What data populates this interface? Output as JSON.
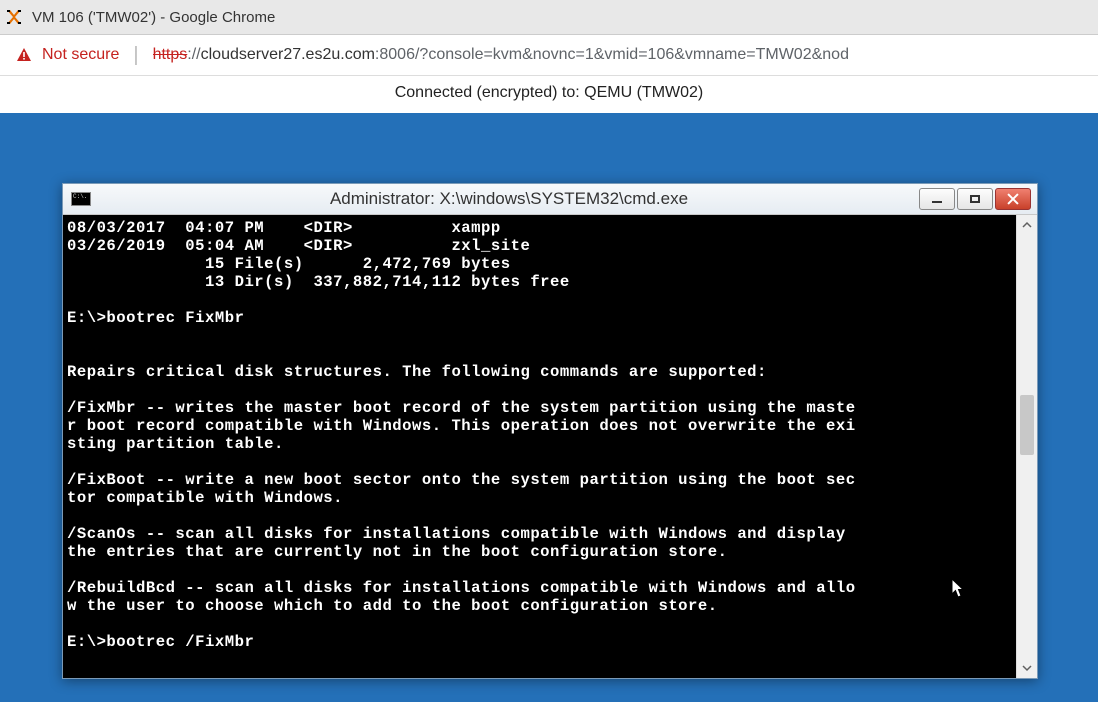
{
  "browser": {
    "tab_title": "VM 106 ('TMW02') - Google Chrome",
    "not_secure_label": "Not secure",
    "url": {
      "scheme_struck": "https",
      "after_scheme": "://",
      "host": "cloudserver27.es2u.com",
      "port": ":8006",
      "rest": "/?console=kvm&novnc=1&vmid=106&vmname=TMW02&nod"
    }
  },
  "novnc": {
    "status": "Connected (encrypted) to: QEMU (TMW02)"
  },
  "cmd": {
    "appicon_text": "C:\\.",
    "title": "Administrator: X:\\windows\\SYSTEM32\\cmd.exe",
    "lines": "08/03/2017  04:07 PM    <DIR>          xampp\n03/26/2019  05:04 AM    <DIR>          zxl_site\n              15 File(s)      2,472,769 bytes\n              13 Dir(s)  337,882,714,112 bytes free\n\nE:\\>bootrec FixMbr\n\n\nRepairs critical disk structures. The following commands are supported:\n\n/FixMbr -- writes the master boot record of the system partition using the maste\nr boot record compatible with Windows. This operation does not overwrite the exi\nsting partition table.\n\n/FixBoot -- write a new boot sector onto the system partition using the boot sec\ntor compatible with Windows.\n\n/ScanOs -- scan all disks for installations compatible with Windows and display\nthe entries that are currently not in the boot configuration store.\n\n/RebuildBcd -- scan all disks for installations compatible with Windows and allo\nw the user to choose which to add to the boot configuration store.\n\nE:\\>bootrec /FixMbr"
  }
}
